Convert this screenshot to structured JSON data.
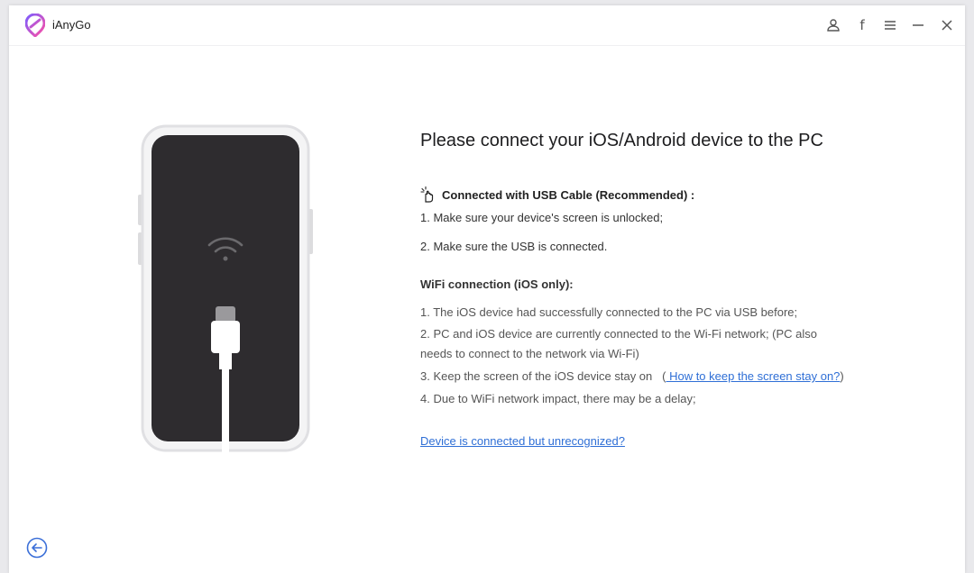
{
  "app": {
    "title": "iAnyGo",
    "colors": {
      "accent": "#2f6fd6",
      "logo_gradient_start": "#7b5cff",
      "logo_gradient_end": "#ff4fa3"
    }
  },
  "titlebar": {
    "icons": [
      "user-icon",
      "facebook-icon",
      "menu-icon",
      "minimize-icon",
      "close-icon"
    ],
    "fb_glyph": "f"
  },
  "main": {
    "heading": "Please connect your iOS/Android device to the PC",
    "usb": {
      "title": "Connected with USB Cable (Recommended) :",
      "steps": [
        "1. Make sure your device's screen is unlocked;",
        "2. Make sure the USB is connected."
      ]
    },
    "wifi": {
      "title": "WiFi connection (iOS only):",
      "steps": [
        "1. The iOS device had successfully connected to the PC via USB before;",
        "2. PC and iOS device are currently connected to the Wi-Fi network; (PC also",
        "needs to connect to the network via Wi-Fi)",
        "3. Keep the screen of the iOS device stay on",
        "4. Due to WiFi network impact, there may be a delay;"
      ],
      "step3_link_open": "(",
      "step3_link": " How to keep the screen stay on?",
      "step3_link_close": ")"
    },
    "unrecognized_link": "Device is connected but unrecognized?"
  }
}
